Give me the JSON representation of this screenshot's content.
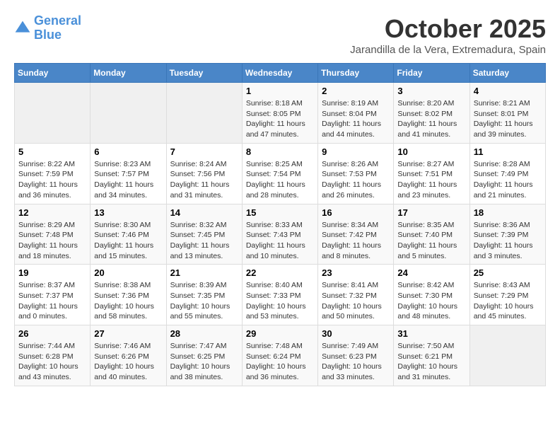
{
  "logo": {
    "line1": "General",
    "line2": "Blue"
  },
  "title": "October 2025",
  "subtitle": "Jarandilla de la Vera, Extremadura, Spain",
  "weekdays": [
    "Sunday",
    "Monday",
    "Tuesday",
    "Wednesday",
    "Thursday",
    "Friday",
    "Saturday"
  ],
  "weeks": [
    [
      {
        "day": "",
        "empty": true
      },
      {
        "day": "",
        "empty": true
      },
      {
        "day": "",
        "empty": true
      },
      {
        "day": "1",
        "lines": [
          "Sunrise: 8:18 AM",
          "Sunset: 8:05 PM",
          "Daylight: 11 hours",
          "and 47 minutes."
        ]
      },
      {
        "day": "2",
        "lines": [
          "Sunrise: 8:19 AM",
          "Sunset: 8:04 PM",
          "Daylight: 11 hours",
          "and 44 minutes."
        ]
      },
      {
        "day": "3",
        "lines": [
          "Sunrise: 8:20 AM",
          "Sunset: 8:02 PM",
          "Daylight: 11 hours",
          "and 41 minutes."
        ]
      },
      {
        "day": "4",
        "lines": [
          "Sunrise: 8:21 AM",
          "Sunset: 8:01 PM",
          "Daylight: 11 hours",
          "and 39 minutes."
        ]
      }
    ],
    [
      {
        "day": "5",
        "lines": [
          "Sunrise: 8:22 AM",
          "Sunset: 7:59 PM",
          "Daylight: 11 hours",
          "and 36 minutes."
        ]
      },
      {
        "day": "6",
        "lines": [
          "Sunrise: 8:23 AM",
          "Sunset: 7:57 PM",
          "Daylight: 11 hours",
          "and 34 minutes."
        ]
      },
      {
        "day": "7",
        "lines": [
          "Sunrise: 8:24 AM",
          "Sunset: 7:56 PM",
          "Daylight: 11 hours",
          "and 31 minutes."
        ]
      },
      {
        "day": "8",
        "lines": [
          "Sunrise: 8:25 AM",
          "Sunset: 7:54 PM",
          "Daylight: 11 hours",
          "and 28 minutes."
        ]
      },
      {
        "day": "9",
        "lines": [
          "Sunrise: 8:26 AM",
          "Sunset: 7:53 PM",
          "Daylight: 11 hours",
          "and 26 minutes."
        ]
      },
      {
        "day": "10",
        "lines": [
          "Sunrise: 8:27 AM",
          "Sunset: 7:51 PM",
          "Daylight: 11 hours",
          "and 23 minutes."
        ]
      },
      {
        "day": "11",
        "lines": [
          "Sunrise: 8:28 AM",
          "Sunset: 7:49 PM",
          "Daylight: 11 hours",
          "and 21 minutes."
        ]
      }
    ],
    [
      {
        "day": "12",
        "lines": [
          "Sunrise: 8:29 AM",
          "Sunset: 7:48 PM",
          "Daylight: 11 hours",
          "and 18 minutes."
        ]
      },
      {
        "day": "13",
        "lines": [
          "Sunrise: 8:30 AM",
          "Sunset: 7:46 PM",
          "Daylight: 11 hours",
          "and 15 minutes."
        ]
      },
      {
        "day": "14",
        "lines": [
          "Sunrise: 8:32 AM",
          "Sunset: 7:45 PM",
          "Daylight: 11 hours",
          "and 13 minutes."
        ]
      },
      {
        "day": "15",
        "lines": [
          "Sunrise: 8:33 AM",
          "Sunset: 7:43 PM",
          "Daylight: 11 hours",
          "and 10 minutes."
        ]
      },
      {
        "day": "16",
        "lines": [
          "Sunrise: 8:34 AM",
          "Sunset: 7:42 PM",
          "Daylight: 11 hours",
          "and 8 minutes."
        ]
      },
      {
        "day": "17",
        "lines": [
          "Sunrise: 8:35 AM",
          "Sunset: 7:40 PM",
          "Daylight: 11 hours",
          "and 5 minutes."
        ]
      },
      {
        "day": "18",
        "lines": [
          "Sunrise: 8:36 AM",
          "Sunset: 7:39 PM",
          "Daylight: 11 hours",
          "and 3 minutes."
        ]
      }
    ],
    [
      {
        "day": "19",
        "lines": [
          "Sunrise: 8:37 AM",
          "Sunset: 7:37 PM",
          "Daylight: 11 hours",
          "and 0 minutes."
        ]
      },
      {
        "day": "20",
        "lines": [
          "Sunrise: 8:38 AM",
          "Sunset: 7:36 PM",
          "Daylight: 10 hours",
          "and 58 minutes."
        ]
      },
      {
        "day": "21",
        "lines": [
          "Sunrise: 8:39 AM",
          "Sunset: 7:35 PM",
          "Daylight: 10 hours",
          "and 55 minutes."
        ]
      },
      {
        "day": "22",
        "lines": [
          "Sunrise: 8:40 AM",
          "Sunset: 7:33 PM",
          "Daylight: 10 hours",
          "and 53 minutes."
        ]
      },
      {
        "day": "23",
        "lines": [
          "Sunrise: 8:41 AM",
          "Sunset: 7:32 PM",
          "Daylight: 10 hours",
          "and 50 minutes."
        ]
      },
      {
        "day": "24",
        "lines": [
          "Sunrise: 8:42 AM",
          "Sunset: 7:30 PM",
          "Daylight: 10 hours",
          "and 48 minutes."
        ]
      },
      {
        "day": "25",
        "lines": [
          "Sunrise: 8:43 AM",
          "Sunset: 7:29 PM",
          "Daylight: 10 hours",
          "and 45 minutes."
        ]
      }
    ],
    [
      {
        "day": "26",
        "lines": [
          "Sunrise: 7:44 AM",
          "Sunset: 6:28 PM",
          "Daylight: 10 hours",
          "and 43 minutes."
        ]
      },
      {
        "day": "27",
        "lines": [
          "Sunrise: 7:46 AM",
          "Sunset: 6:26 PM",
          "Daylight: 10 hours",
          "and 40 minutes."
        ]
      },
      {
        "day": "28",
        "lines": [
          "Sunrise: 7:47 AM",
          "Sunset: 6:25 PM",
          "Daylight: 10 hours",
          "and 38 minutes."
        ]
      },
      {
        "day": "29",
        "lines": [
          "Sunrise: 7:48 AM",
          "Sunset: 6:24 PM",
          "Daylight: 10 hours",
          "and 36 minutes."
        ]
      },
      {
        "day": "30",
        "lines": [
          "Sunrise: 7:49 AM",
          "Sunset: 6:23 PM",
          "Daylight: 10 hours",
          "and 33 minutes."
        ]
      },
      {
        "day": "31",
        "lines": [
          "Sunrise: 7:50 AM",
          "Sunset: 6:21 PM",
          "Daylight: 10 hours",
          "and 31 minutes."
        ]
      },
      {
        "day": "",
        "empty": true
      }
    ]
  ]
}
